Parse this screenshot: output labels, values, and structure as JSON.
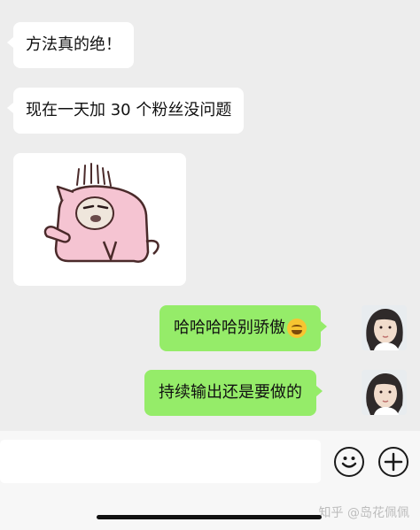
{
  "messages": {
    "m1": "方法真的绝！",
    "m2": "现在一天加 30 个粉丝没问题",
    "m4": "哈哈哈哈别骄傲",
    "m5": "持续输出还是要做的"
  },
  "icons": {
    "sticker": "pink-cat-sticker",
    "emoji": "smirk-laugh-emoji",
    "smiley": "emoji-button-icon",
    "plus": "add-button-icon"
  },
  "watermark": "知乎 @岛花佩佩",
  "colors": {
    "background": "#ededed",
    "incoming_bubble": "#ffffff",
    "outgoing_bubble": "#95ec69"
  }
}
